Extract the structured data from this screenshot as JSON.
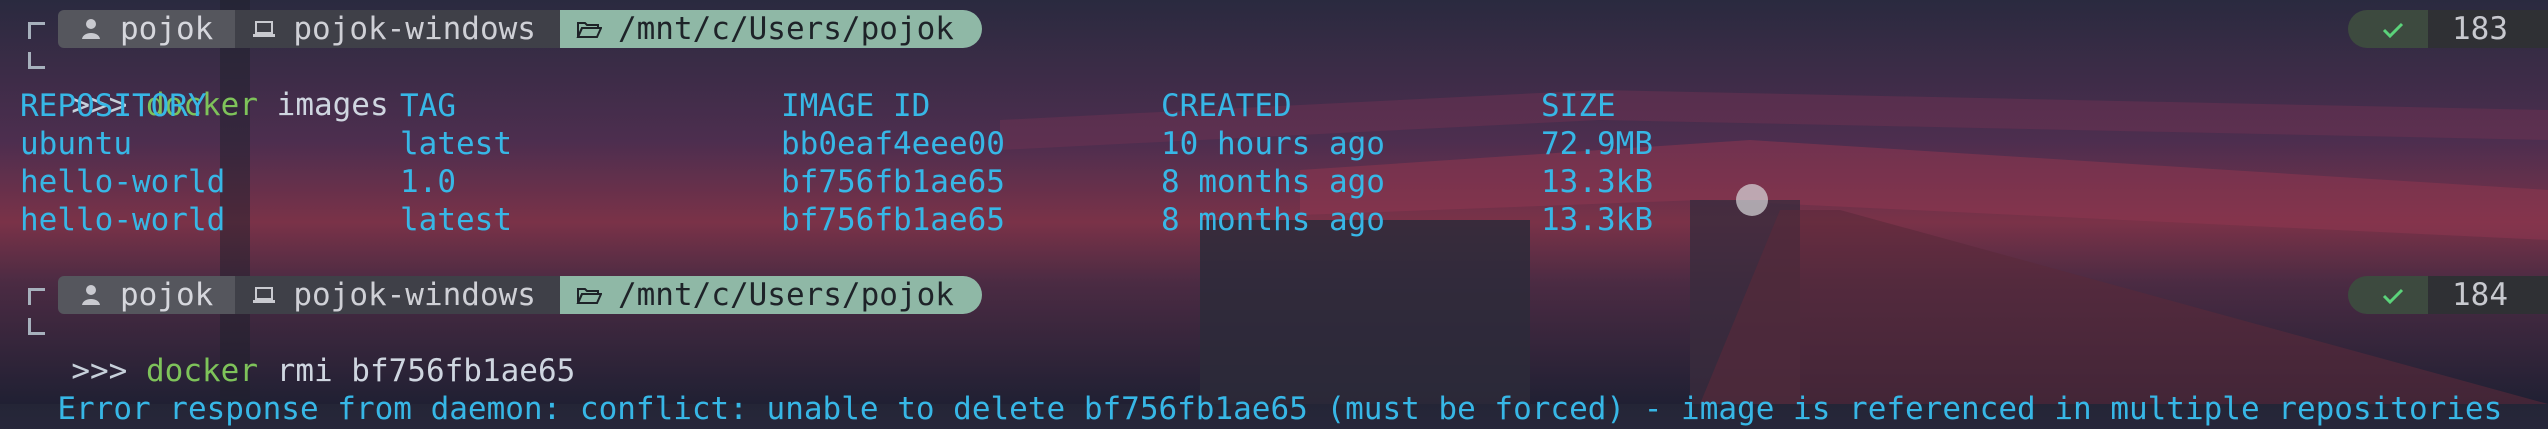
{
  "prompt1": {
    "user": "pojok",
    "host": "pojok-windows",
    "path": "/mnt/c/Users/pojok",
    "status_icon": "check-icon",
    "count": "183",
    "prefix": ">>>",
    "command": "docker",
    "args": "images"
  },
  "images_table": {
    "headers": [
      "REPOSITORY",
      "TAG",
      "IMAGE ID",
      "CREATED",
      "SIZE"
    ],
    "rows": [
      [
        "ubuntu",
        "latest",
        "bb0eaf4eee00",
        "10 hours ago",
        "72.9MB"
      ],
      [
        "hello-world",
        "1.0",
        "bf756fb1ae65",
        "8 months ago",
        "13.3kB"
      ],
      [
        "hello-world",
        "latest",
        "bf756fb1ae65",
        "8 months ago",
        "13.3kB"
      ]
    ]
  },
  "prompt2": {
    "user": "pojok",
    "host": "pojok-windows",
    "path": "/mnt/c/Users/pojok",
    "status_icon": "check-icon",
    "count": "184",
    "prefix": ">>>",
    "command": "docker",
    "args": "rmi bf756fb1ae65"
  },
  "error_line": "Error response from daemon: conflict: unable to delete bf756fb1ae65 (must be forced) - image is referenced in multiple repositories",
  "colors": {
    "command_green": "#7ec35a",
    "output_cyan": "#37b7e6",
    "path_segment": "#8fb8a6",
    "status_ok_green": "#5bd37a"
  }
}
